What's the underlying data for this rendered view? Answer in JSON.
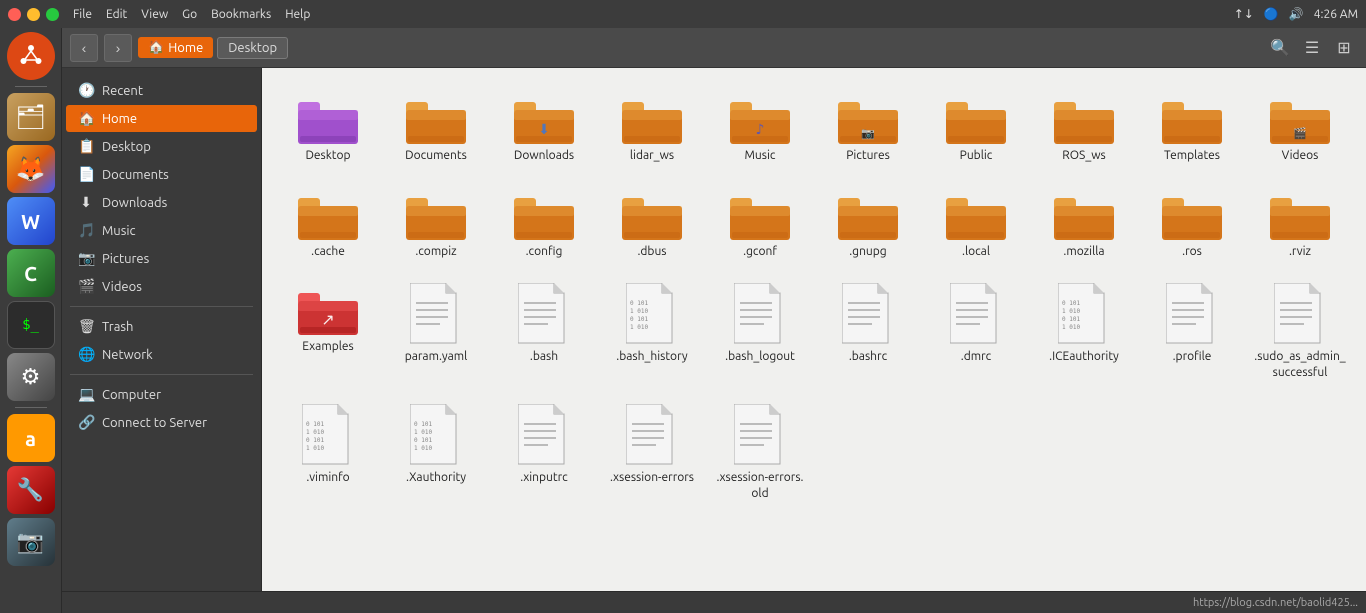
{
  "titlebar": {
    "menus": [
      "File",
      "Edit",
      "View",
      "Go",
      "Bookmarks",
      "Help"
    ],
    "time": "4:26 AM",
    "status_icons": [
      "↑↓",
      "🔵",
      "🔊"
    ]
  },
  "toolbar": {
    "back_label": "‹",
    "forward_label": "›",
    "home_crumb": "Home",
    "desktop_crumb": "Desktop",
    "search_icon": "🔍",
    "view_list_icon": "≡",
    "view_grid_icon": "⊞"
  },
  "sidebar": {
    "items": [
      {
        "id": "recent",
        "label": "Recent",
        "icon": "🕐"
      },
      {
        "id": "home",
        "label": "Home",
        "icon": "🏠",
        "active": true
      },
      {
        "id": "desktop",
        "label": "Desktop",
        "icon": "📋"
      },
      {
        "id": "documents",
        "label": "Documents",
        "icon": "📄"
      },
      {
        "id": "downloads",
        "label": "Downloads",
        "icon": "⬇"
      },
      {
        "id": "music",
        "label": "Music",
        "icon": "🎵"
      },
      {
        "id": "pictures",
        "label": "Pictures",
        "icon": "📷"
      },
      {
        "id": "videos",
        "label": "Videos",
        "icon": "🎬"
      },
      {
        "id": "trash",
        "label": "Trash",
        "icon": "🗑"
      },
      {
        "id": "network",
        "label": "Network",
        "icon": "🌐"
      },
      {
        "id": "computer",
        "label": "Computer",
        "icon": "💻"
      },
      {
        "id": "connect",
        "label": "Connect to Server",
        "icon": "🔗"
      }
    ]
  },
  "files": {
    "folders": [
      {
        "name": "Desktop",
        "type": "folder",
        "special": "desktop"
      },
      {
        "name": "Documents",
        "type": "folder",
        "special": "documents"
      },
      {
        "name": "Downloads",
        "type": "folder",
        "special": "downloads"
      },
      {
        "name": "lidar_ws",
        "type": "folder",
        "special": "normal"
      },
      {
        "name": "Music",
        "type": "folder",
        "special": "music"
      },
      {
        "name": "Pictures",
        "type": "folder",
        "special": "pictures"
      },
      {
        "name": "Public",
        "type": "folder",
        "special": "normal"
      },
      {
        "name": "ROS_ws",
        "type": "folder",
        "special": "normal"
      },
      {
        "name": "Templates",
        "type": "folder",
        "special": "templates"
      },
      {
        "name": "Videos",
        "type": "folder",
        "special": "videos"
      },
      {
        "name": ".cache",
        "type": "folder",
        "special": "normal"
      },
      {
        "name": ".compiz",
        "type": "folder",
        "special": "normal"
      },
      {
        "name": ".config",
        "type": "folder",
        "special": "normal"
      },
      {
        "name": ".dbus",
        "type": "folder",
        "special": "normal"
      },
      {
        "name": ".gconf",
        "type": "folder",
        "special": "normal"
      },
      {
        "name": ".gnupg",
        "type": "folder",
        "special": "normal"
      },
      {
        "name": ".local",
        "type": "folder",
        "special": "normal"
      },
      {
        "name": ".mozilla",
        "type": "folder",
        "special": "normal"
      },
      {
        "name": ".ros",
        "type": "folder",
        "special": "normal"
      },
      {
        "name": ".rviz",
        "type": "folder",
        "special": "normal"
      },
      {
        "name": "Examples",
        "type": "folder",
        "special": "examples"
      }
    ],
    "text_files": [
      {
        "name": "param.yaml",
        "type": "text"
      },
      {
        "name": ".bash",
        "type": "text"
      },
      {
        "name": ".bash_history",
        "type": "binary"
      },
      {
        "name": ".bash_logout",
        "type": "text"
      },
      {
        "name": ".bashrc",
        "type": "text"
      },
      {
        "name": ".dmrc",
        "type": "text"
      },
      {
        "name": ".ICEauthority",
        "type": "binary"
      },
      {
        "name": ".profile",
        "type": "text"
      },
      {
        "name": ".sudo_as_admin_successful",
        "type": "text"
      },
      {
        "name": ".viminfo",
        "type": "binary"
      },
      {
        "name": ".Xauthority",
        "type": "binary"
      },
      {
        "name": ".xinputrc",
        "type": "text"
      },
      {
        "name": ".xsession-errors",
        "type": "text"
      },
      {
        "name": ".xsession-errors.old",
        "type": "text"
      }
    ]
  },
  "statusbar": {
    "url": "https://blog.csdn.net/baolid425..."
  }
}
